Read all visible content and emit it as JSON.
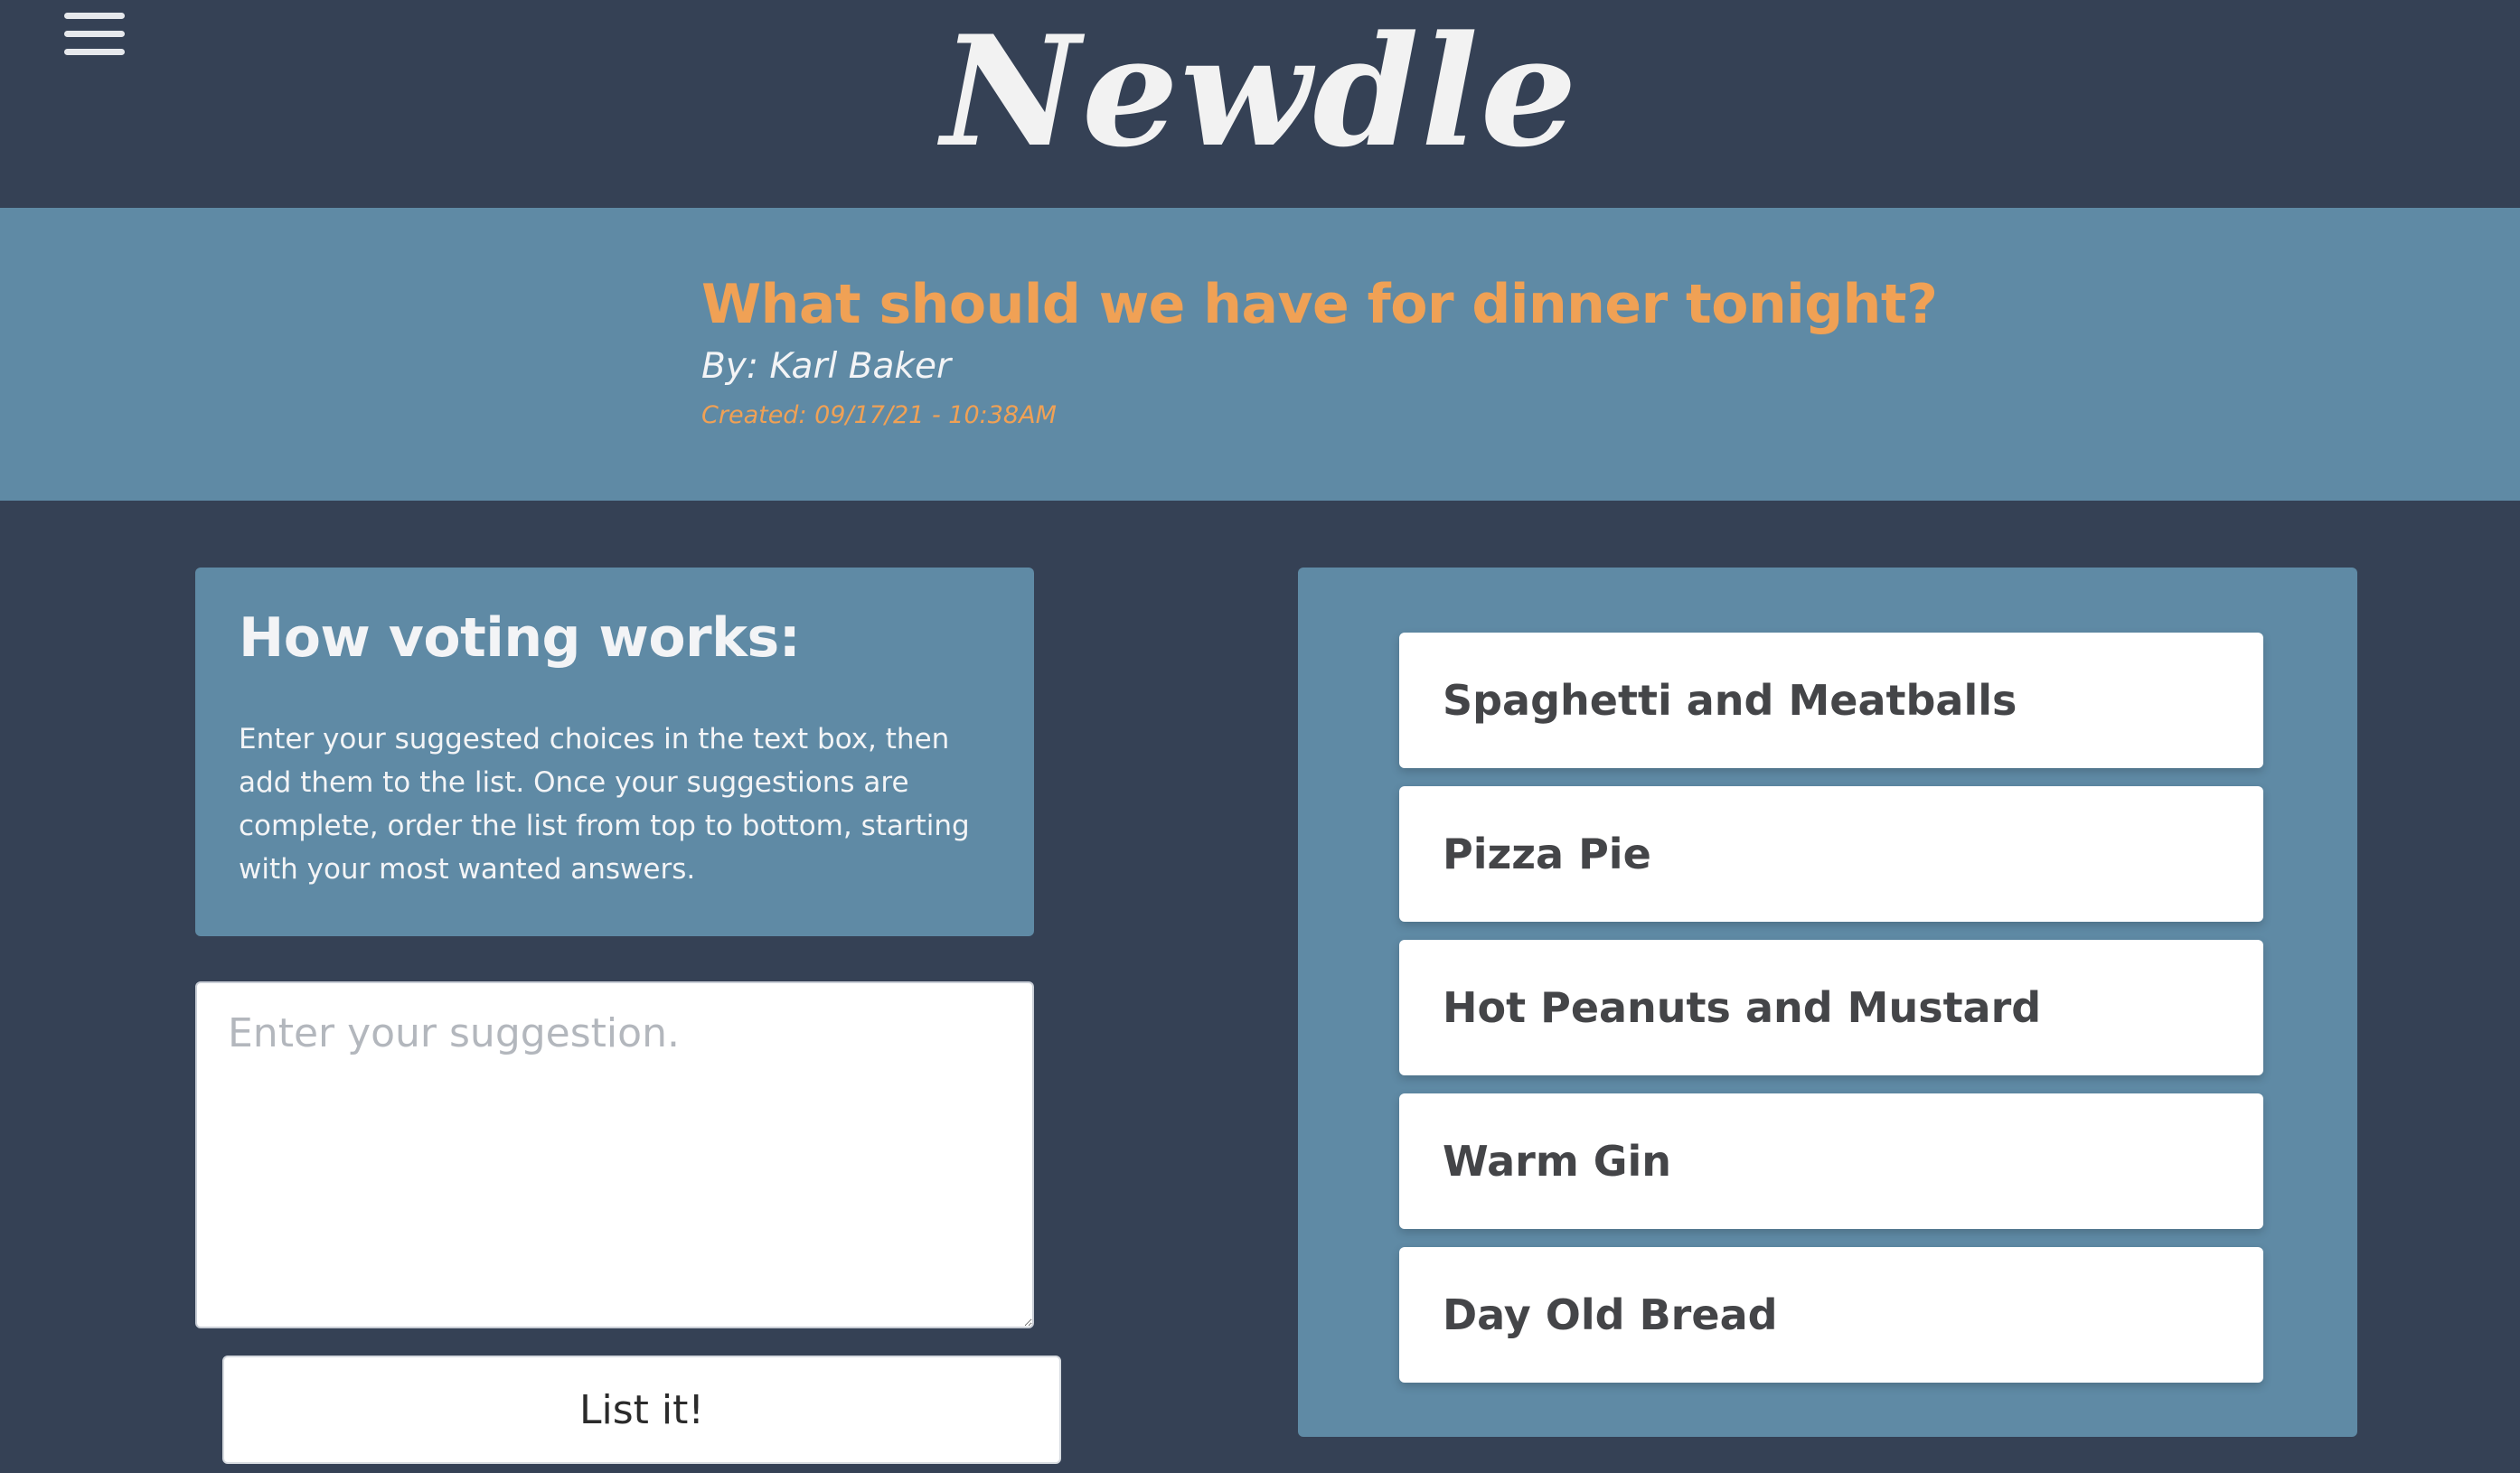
{
  "app": {
    "logo": "Newdle",
    "menu_icon": "hamburger-menu-icon"
  },
  "poll": {
    "title": "What should we have for dinner tonight?",
    "author": "By: Karl Baker",
    "created": "Created: 09/17/21 - 10:38AM"
  },
  "info": {
    "heading": "How voting works:",
    "text": "Enter your suggested choices in the text box, then add them to the list. Once your suggestions are complete, order the list from top to bottom, starting with your most wanted answers."
  },
  "suggestion": {
    "placeholder": "Enter your suggestion.",
    "value": "",
    "button_label": "List it!"
  },
  "choices": [
    {
      "label": "Spaghetti and Meatballs"
    },
    {
      "label": "Pizza Pie"
    },
    {
      "label": "Hot Peanuts and Mustard"
    },
    {
      "label": "Warm Gin"
    },
    {
      "label": "Day Old Bread"
    }
  ],
  "colors": {
    "background": "#354155",
    "panel": "#5f8aa5",
    "accent": "#f0a155",
    "text_light": "#f3f4f6"
  }
}
